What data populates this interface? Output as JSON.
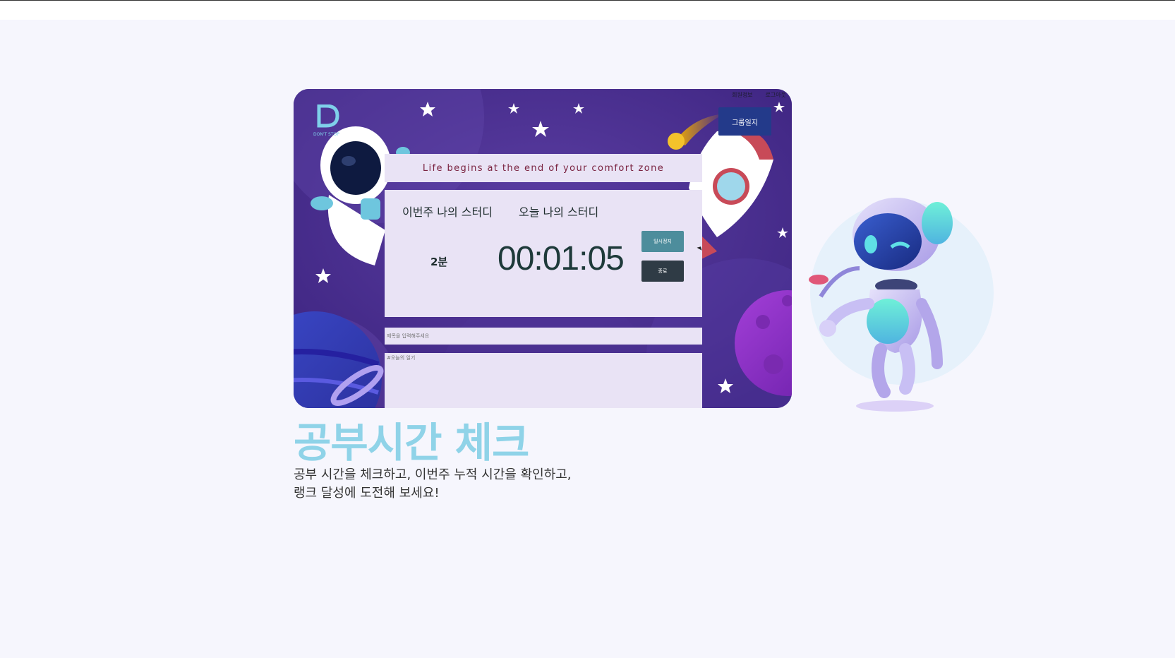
{
  "nav": {
    "member_info": "회원정보",
    "logout": "로그아웃",
    "group_diary": "그룹일지"
  },
  "logo": {
    "text": "DON'T STOP"
  },
  "quote": "Life begins at the end of your comfort zone",
  "timer": {
    "week_label": "이번주 나의 스터디",
    "today_label": "오늘 나의 스터디",
    "week_value": "2분",
    "clock": "00:01:05",
    "pause_label": "일시정지",
    "end_label": "종료"
  },
  "form": {
    "title_placeholder": "제목을 입력해주세요",
    "body_placeholder": "#오늘의 일기"
  },
  "feature": {
    "title": "공부시간 체크",
    "desc_line1": "공부 시간을 체크하고, 이번주 누적 시간을 확인하고,",
    "desc_line2": "랭크 달성에 도전해 보세요!"
  },
  "colors": {
    "accent_title": "#8fd3e8",
    "pause_button": "#4d8d9c",
    "end_button": "#2f3b45",
    "group_button": "#233a8a",
    "panel": "#e9e3f5"
  }
}
